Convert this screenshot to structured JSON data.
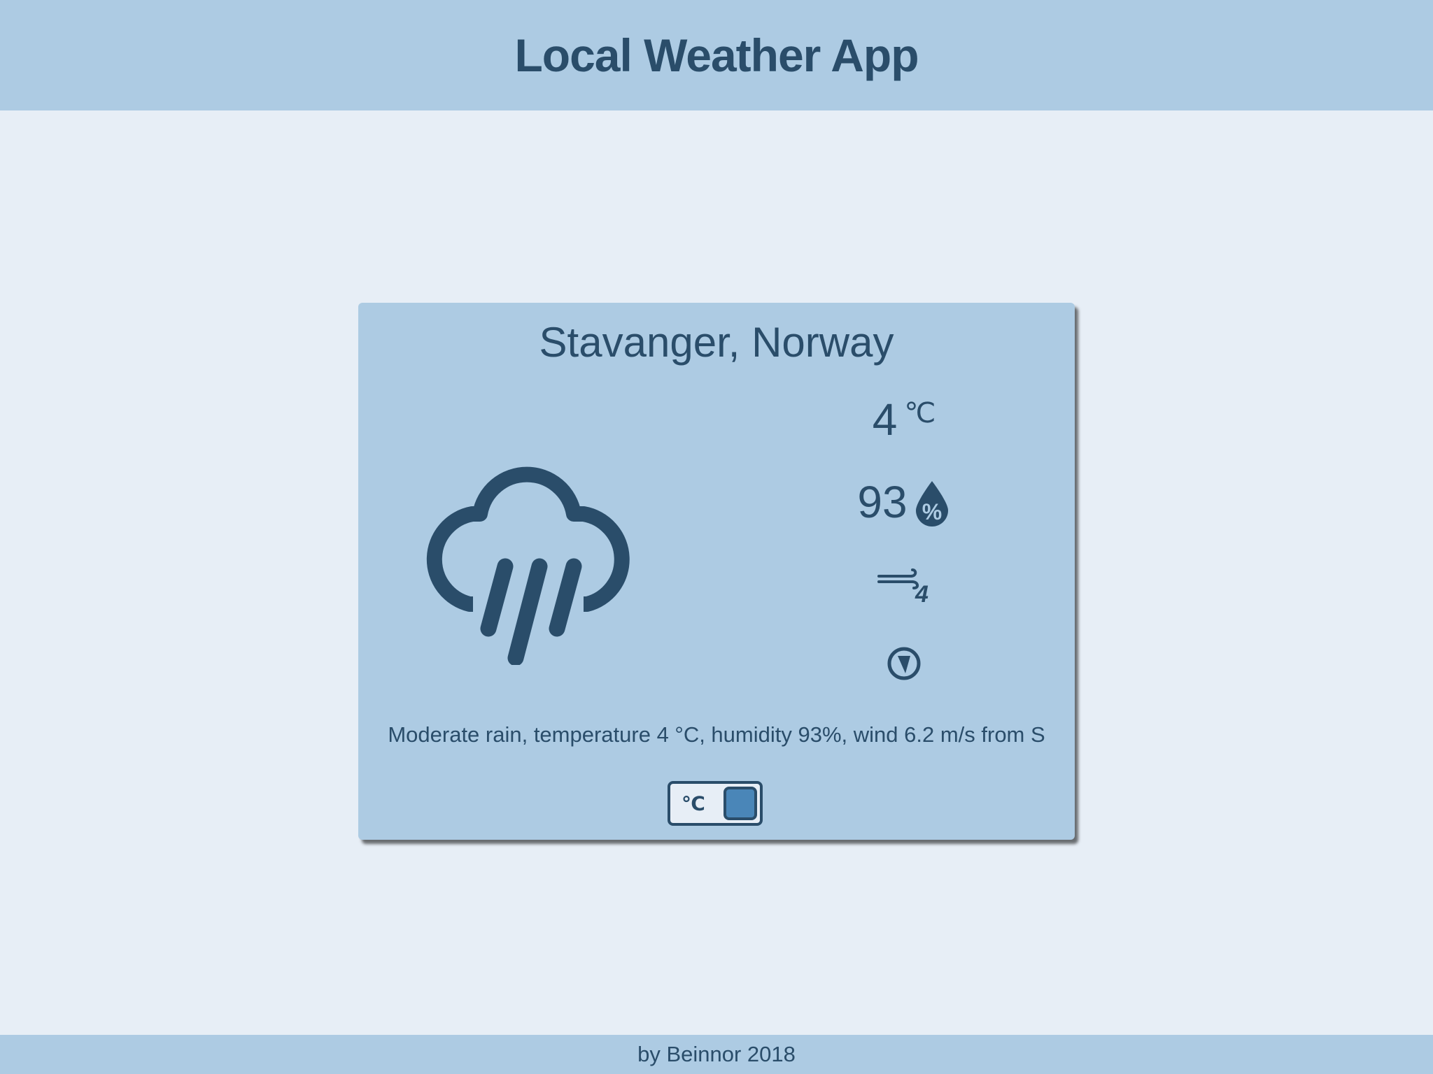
{
  "header": {
    "title": "Local Weather App"
  },
  "card": {
    "location": "Stavanger, Norway",
    "weather_icon": "rain-cloud-icon",
    "temperature": {
      "value": "4",
      "unit": "℃"
    },
    "humidity": {
      "value": "93",
      "icon": "humidity-drop-icon"
    },
    "wind": {
      "icon": "wind-force-icon",
      "force": "4"
    },
    "direction": {
      "icon": "wind-direction-icon"
    },
    "summary": "Moderate rain, temperature 4 °C, humidity 93%, wind 6.2 m/s from S",
    "unit_toggle": {
      "label": "℃"
    }
  },
  "footer": {
    "text": "by Beinnor 2018"
  },
  "colors": {
    "primary": "#2a4d6a",
    "panel": "#adcbe3",
    "background": "#e7eef6",
    "accent": "#4a86b8"
  }
}
